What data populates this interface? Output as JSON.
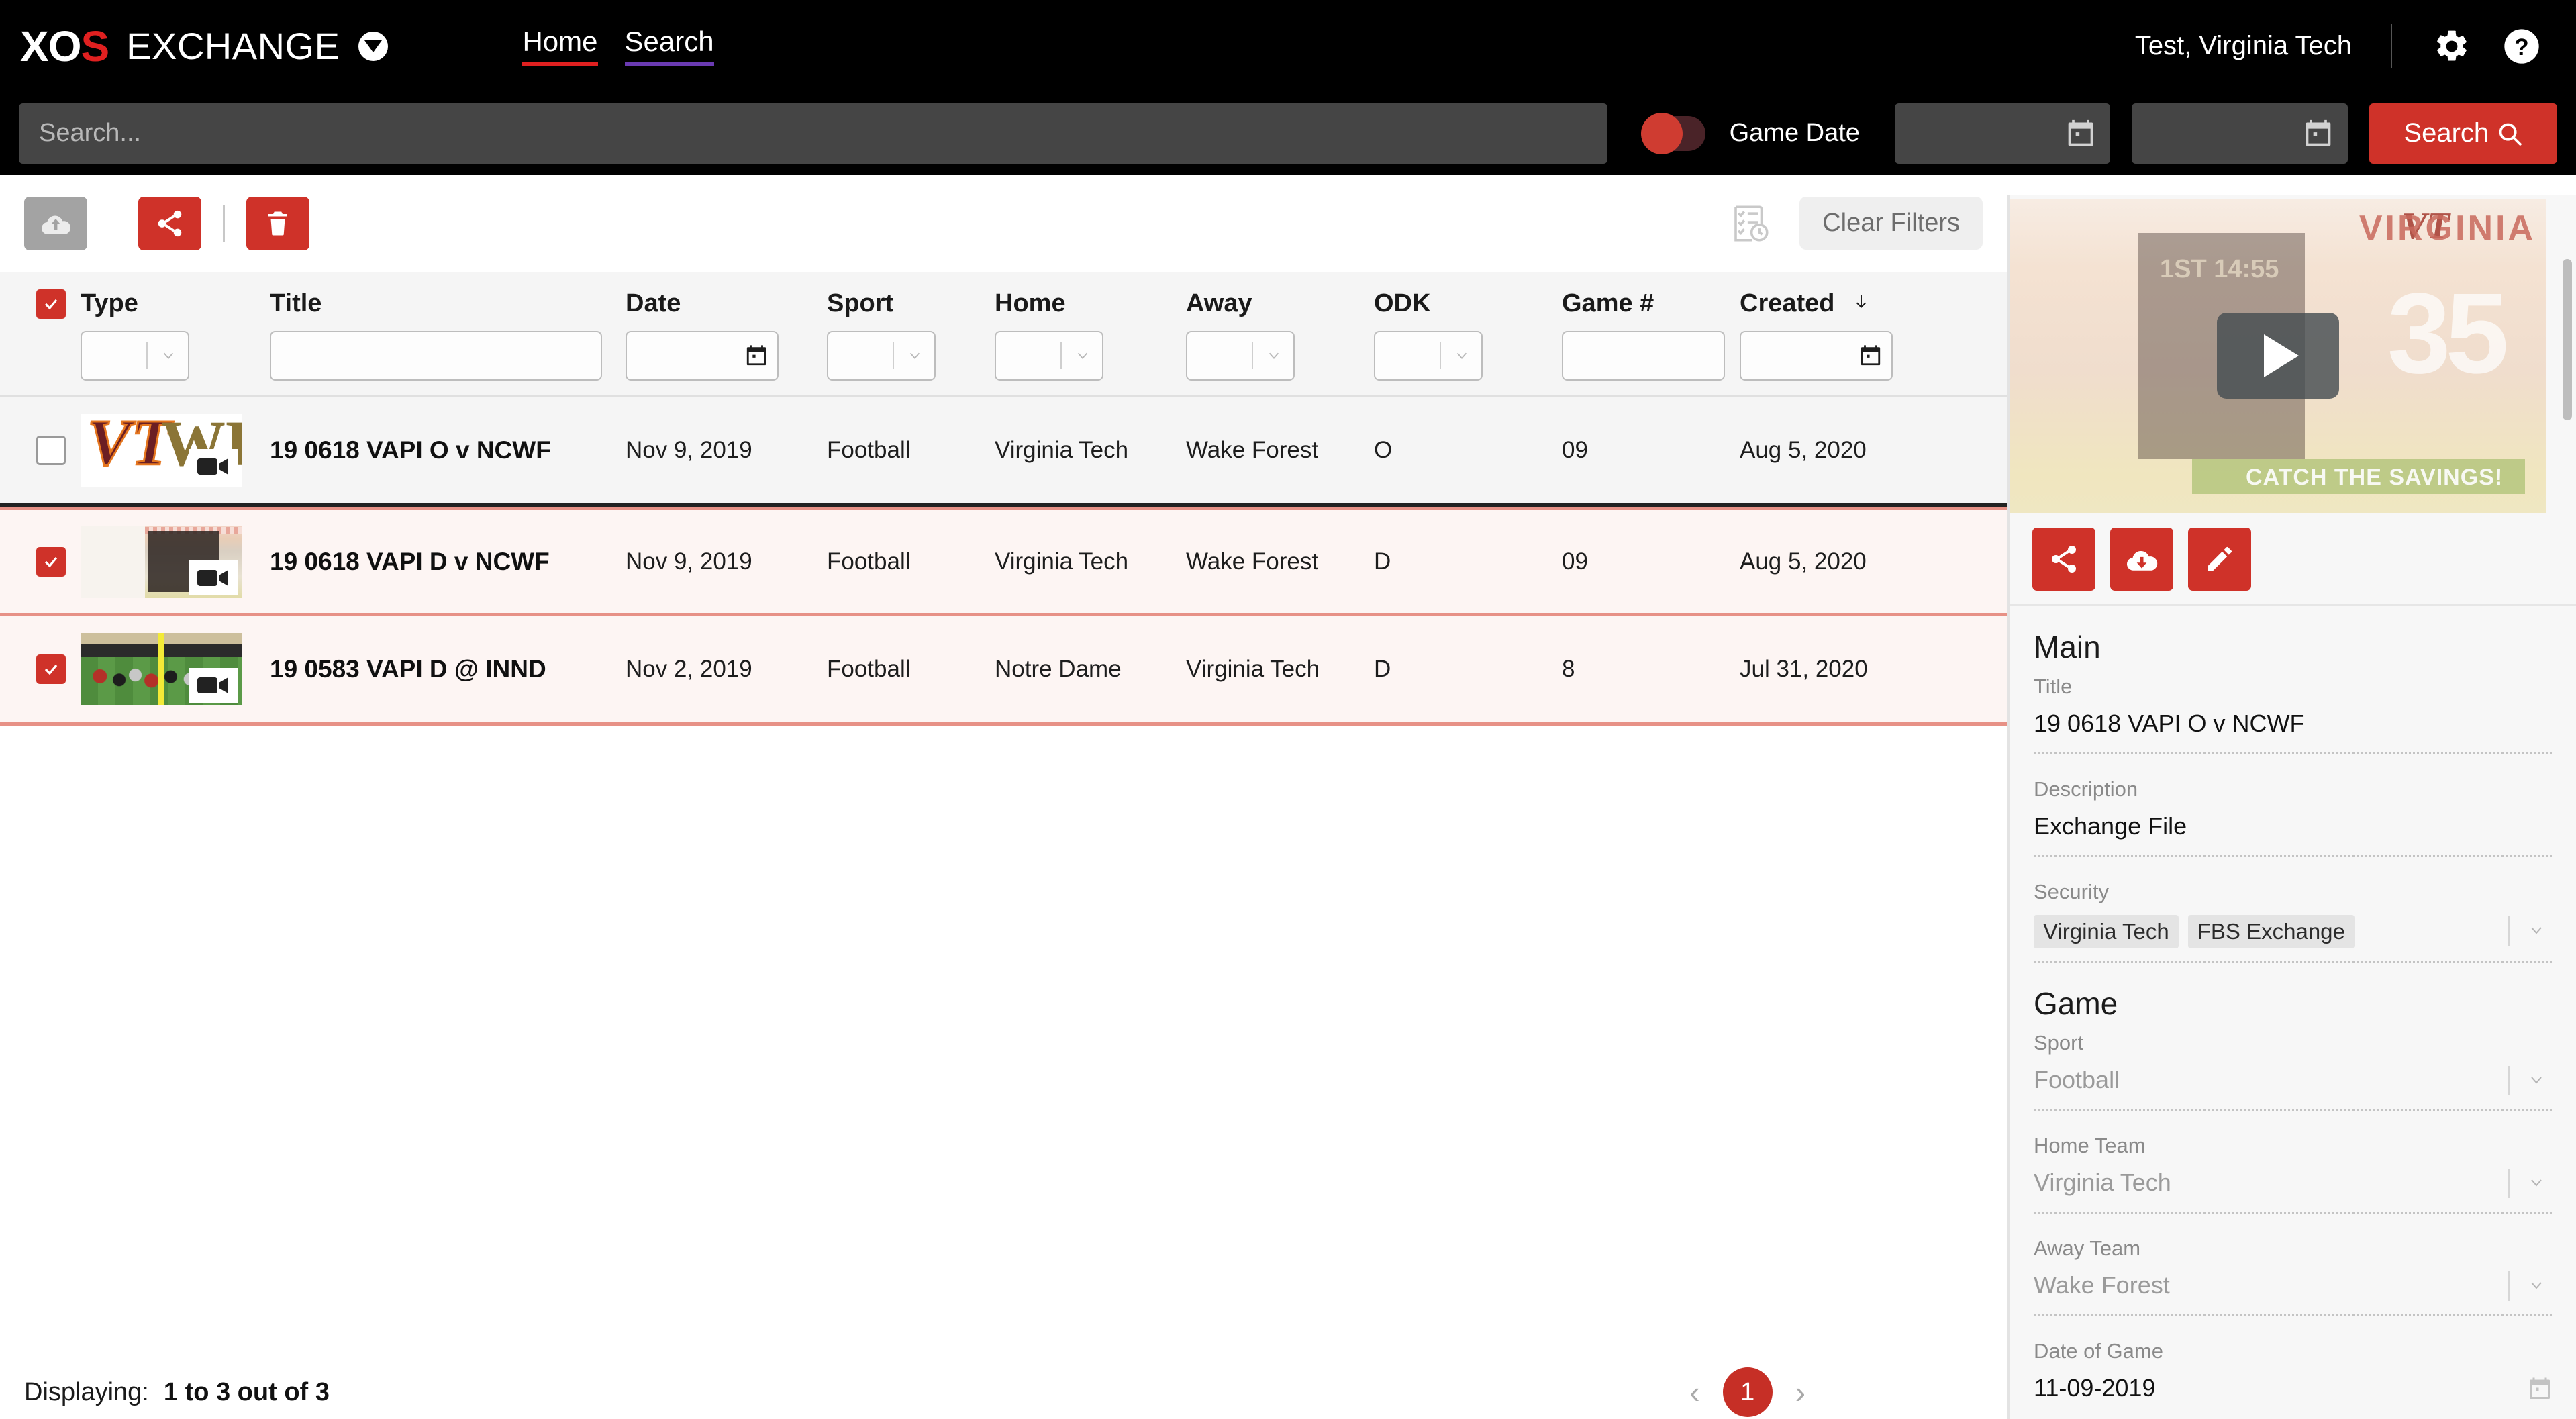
{
  "header": {
    "logo_xos_white": "XO",
    "logo_xos_red": "S",
    "logo_exchange": "EXCHANGE",
    "logo_caret_icon": "chevron-down-circle-icon",
    "nav": [
      {
        "label": "Home",
        "underline_color": "#e02020"
      },
      {
        "label": "Search",
        "underline_color": "#6a3ab2"
      }
    ],
    "user": "Test, Virginia Tech",
    "settings_icon": "gear-icon",
    "help_icon": "question-circle-icon"
  },
  "searchbar": {
    "placeholder": "Search...",
    "value": "",
    "toggle_label": "Game Date",
    "toggle_on": false,
    "toggle_color": "#cf3c31",
    "date_from": "",
    "date_to": "",
    "date_icon": "calendar-icon",
    "search_button": "Search",
    "search_button_icon": "magnifier-icon",
    "search_button_color": "#cf3229"
  },
  "toolbar": {
    "upload_icon": "cloud-upload-icon",
    "upload_enabled": false,
    "share_icon": "share-icon",
    "delete_icon": "trash-icon",
    "history_icon": "checklist-clock-icon",
    "clear_filters_label": "Clear Filters"
  },
  "table": {
    "select_all_checked": true,
    "columns": [
      {
        "key": "type",
        "label": "Type",
        "filter": "select"
      },
      {
        "key": "title",
        "label": "Title",
        "filter": "text"
      },
      {
        "key": "date",
        "label": "Date",
        "filter": "date"
      },
      {
        "key": "sport",
        "label": "Sport",
        "filter": "select"
      },
      {
        "key": "home",
        "label": "Home",
        "filter": "select"
      },
      {
        "key": "away",
        "label": "Away",
        "filter": "select"
      },
      {
        "key": "odk",
        "label": "ODK",
        "filter": "select"
      },
      {
        "key": "game",
        "label": "Game #",
        "filter": "text"
      },
      {
        "key": "created",
        "label": "Created",
        "filter": "date",
        "sorted": "desc",
        "sort_icon": "arrow-down-icon"
      }
    ],
    "filter_values": {
      "type": "",
      "title": "",
      "date": "",
      "sport": "",
      "home": "",
      "away": "",
      "odk": "",
      "game": "",
      "created": ""
    },
    "rows": [
      {
        "selected": false,
        "thumbnail": "vt-wf-logos-thumbnail",
        "title": "19 0618 VAPI O v NCWF",
        "date": "Nov 9, 2019",
        "sport": "Football",
        "home": "Virginia Tech",
        "away": "Wake Forest",
        "odk": "O",
        "game": "09",
        "created": "Aug 5, 2020"
      },
      {
        "selected": true,
        "thumbnail": "scoreboard-thumbnail",
        "title": "19 0618 VAPI D v NCWF",
        "date": "Nov 9, 2019",
        "sport": "Football",
        "home": "Virginia Tech",
        "away": "Wake Forest",
        "odk": "D",
        "game": "09",
        "created": "Aug 5, 2020"
      },
      {
        "selected": true,
        "thumbnail": "field-play-thumbnail",
        "title": "19 0583 VAPI D @ INND",
        "date": "Nov 2, 2019",
        "sport": "Football",
        "home": "Notre Dame",
        "away": "Virginia Tech",
        "odk": "D",
        "game": "8",
        "created": "Jul 31, 2020"
      }
    ]
  },
  "footer": {
    "displaying_label": "Displaying:",
    "displaying_value": "1 to 3 out of 3",
    "prev_icon": "chevron-left-icon",
    "next_icon": "chevron-right-icon",
    "current_page": "1"
  },
  "detail": {
    "video": {
      "play_icon": "play-icon",
      "vt_mark": "VT",
      "vironia": "VIRGINIA",
      "jersey_number": "35",
      "banner_text": "CATCH THE SAVINGS!",
      "score_text": "1ST 14:55"
    },
    "actions": {
      "share_icon": "share-icon",
      "download_icon": "cloud-download-icon",
      "edit_icon": "pencil-icon"
    },
    "sections": [
      {
        "title": "Main",
        "fields": [
          {
            "label": "Title",
            "value": "19 0618 VAPI O v NCWF",
            "type": "text"
          },
          {
            "label": "Description",
            "value": "Exchange File",
            "type": "text"
          },
          {
            "label": "Security",
            "type": "chips",
            "chips": [
              "Virginia Tech",
              "FBS Exchange"
            ],
            "chevron": "chevron-down-icon"
          }
        ]
      },
      {
        "title": "Game",
        "fields": [
          {
            "label": "Sport",
            "value": "Football",
            "type": "select",
            "chevron": "chevron-down-icon"
          },
          {
            "label": "Home Team",
            "value": "Virginia Tech",
            "type": "select",
            "chevron": "chevron-down-icon"
          },
          {
            "label": "Away Team",
            "value": "Wake Forest",
            "type": "select",
            "chevron": "chevron-down-icon"
          },
          {
            "label": "Date of Game",
            "value": "11-09-2019",
            "type": "date",
            "icon": "calendar-icon"
          }
        ]
      }
    ]
  },
  "colors": {
    "brand_red": "#cf3229",
    "header_black": "#000000",
    "selected_row": "#fdf5f3",
    "selected_border": "#e79186",
    "unselected_row": "#f5f5f5"
  }
}
